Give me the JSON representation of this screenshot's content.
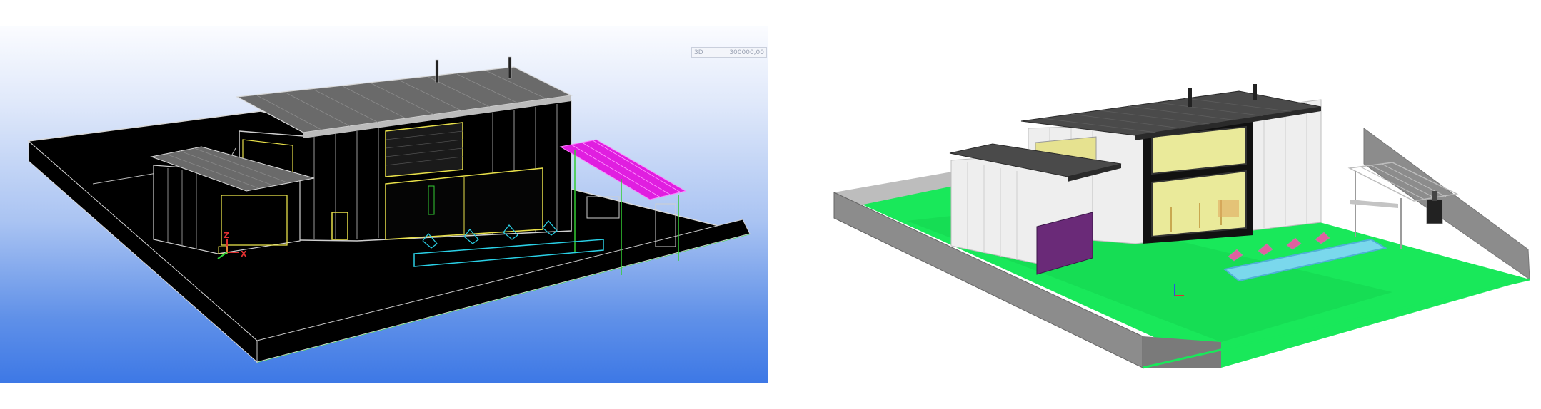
{
  "viewport_wireframe": {
    "view_name": "3D",
    "scale_value": "300000,00",
    "axis": {
      "z_label": "Z",
      "x_label": "X"
    },
    "colors": {
      "model_fill": "#000000",
      "edge": "#d8d8d8",
      "ground_edge": "#2bd63a",
      "pergola": "#e01ee0",
      "pool": "#2ad0e6",
      "window_frame": "#e8e04a"
    }
  },
  "viewport_shaded": {
    "axis_indicator": "axis-triad-icon",
    "colors": {
      "lawn": "#19e85a",
      "wall": "#8c8c8c",
      "roof": "#4a4a4a",
      "cladding": "#eeeeee",
      "glass": "#eaea9a",
      "garage_door": "#6a2a78",
      "pool": "#7ad8ec"
    }
  }
}
